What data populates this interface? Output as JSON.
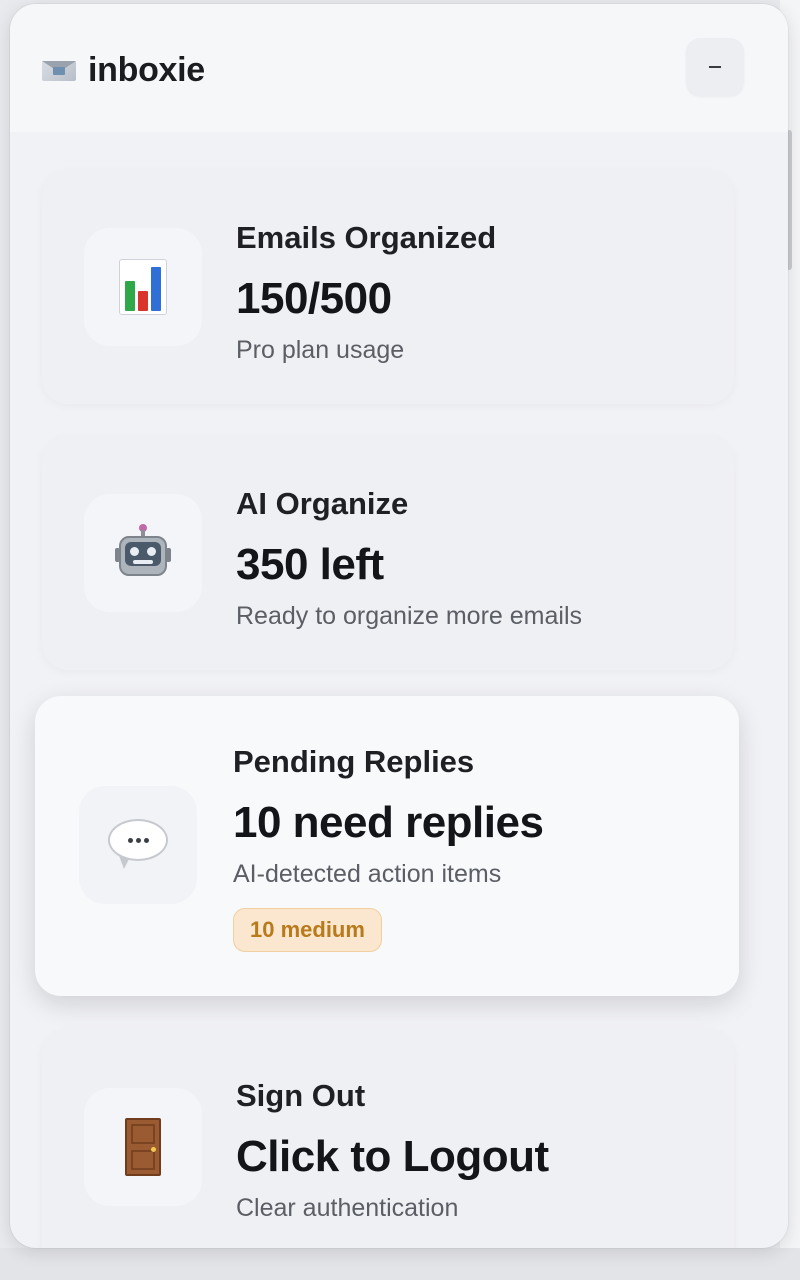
{
  "app": {
    "name": "inboxie",
    "brand_icon": "envelope-icon",
    "minimize_label": "–"
  },
  "cards": [
    {
      "id": "emails-organized",
      "icon": "bar-chart-icon",
      "title": "Emails Organized",
      "value": "150/500",
      "subtitle": "Pro plan usage"
    },
    {
      "id": "ai-organize",
      "icon": "robot-icon",
      "title": "AI Organize",
      "value": "350 left",
      "subtitle": "Ready to organize more emails"
    },
    {
      "id": "pending-replies",
      "icon": "speech-bubble-icon",
      "title": "Pending Replies",
      "value": "10 need replies",
      "subtitle": "AI-detected action items",
      "badge": "10 medium",
      "badge_color": "#b87a1a"
    },
    {
      "id": "sign-out",
      "icon": "door-icon",
      "title": "Sign Out",
      "value": "Click to Logout",
      "subtitle": "Clear authentication"
    }
  ],
  "colors": {
    "panel_bg": "#f1f2f6",
    "text_primary": "#141518",
    "text_secondary": "#5b5e65",
    "badge_bg": "#fbe7cf"
  }
}
